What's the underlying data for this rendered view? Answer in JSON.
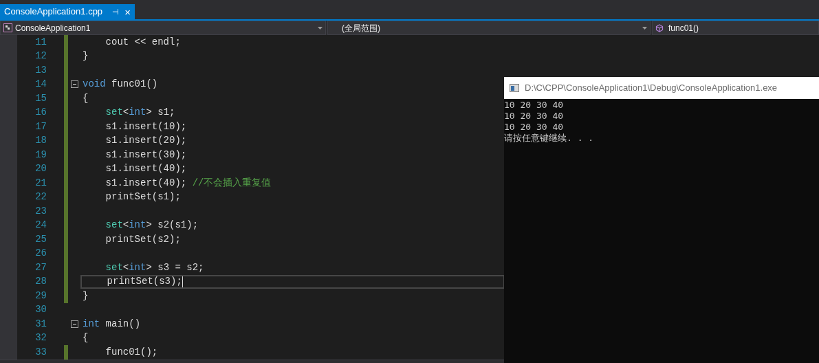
{
  "tab": {
    "title": "ConsoleApplication1.cpp",
    "pin": "⊣",
    "close": "×",
    "selected": true
  },
  "nav": {
    "project": "ConsoleApplication1",
    "scope": "(全局范围)",
    "member": "func01()"
  },
  "editor": {
    "lines": [
      {
        "number": "11",
        "changed": true,
        "fold": false,
        "current": false,
        "tokens": [
          {
            "kind": "plain",
            "text": "    cout << endl;"
          }
        ]
      },
      {
        "number": "12",
        "changed": true,
        "fold": false,
        "current": false,
        "tokens": [
          {
            "kind": "plain",
            "text": "}"
          }
        ]
      },
      {
        "number": "13",
        "changed": true,
        "fold": false,
        "current": false
      },
      {
        "number": "14",
        "changed": true,
        "fold": true,
        "current": false,
        "tokens": [
          {
            "kind": "keyword",
            "text": "void"
          },
          {
            "kind": "plain",
            "text": " func01()"
          }
        ]
      },
      {
        "number": "15",
        "changed": true,
        "fold": false,
        "current": false,
        "tokens": [
          {
            "kind": "plain",
            "text": "{"
          }
        ]
      },
      {
        "number": "16",
        "changed": true,
        "fold": false,
        "current": false,
        "tokens": [
          {
            "kind": "type",
            "text": "    set"
          },
          {
            "kind": "plain",
            "text": "<"
          },
          {
            "kind": "keyword",
            "text": "int"
          },
          {
            "kind": "plain",
            "text": "> s1;"
          }
        ]
      },
      {
        "number": "17",
        "changed": true,
        "fold": false,
        "current": false,
        "tokens": [
          {
            "kind": "plain",
            "text": "    s1.insert(10);"
          }
        ]
      },
      {
        "number": "18",
        "changed": true,
        "fold": false,
        "current": false,
        "tokens": [
          {
            "kind": "plain",
            "text": "    s1.insert(20);"
          }
        ]
      },
      {
        "number": "19",
        "changed": true,
        "fold": false,
        "current": false,
        "tokens": [
          {
            "kind": "plain",
            "text": "    s1.insert(30);"
          }
        ]
      },
      {
        "number": "20",
        "changed": true,
        "fold": false,
        "current": false,
        "tokens": [
          {
            "kind": "plain",
            "text": "    s1.insert(40);"
          }
        ]
      },
      {
        "number": "21",
        "changed": true,
        "fold": false,
        "current": false,
        "tokens": [
          {
            "kind": "plain",
            "text": "    s1.insert(40); "
          },
          {
            "kind": "comment",
            "text": "//不会插入重复值"
          }
        ]
      },
      {
        "number": "22",
        "changed": true,
        "fold": false,
        "current": false,
        "tokens": [
          {
            "kind": "plain",
            "text": "    printSet(s1);"
          }
        ]
      },
      {
        "number": "23",
        "changed": true,
        "fold": false,
        "current": false
      },
      {
        "number": "24",
        "changed": true,
        "fold": false,
        "current": false,
        "tokens": [
          {
            "kind": "type",
            "text": "    set"
          },
          {
            "kind": "plain",
            "text": "<"
          },
          {
            "kind": "keyword",
            "text": "int"
          },
          {
            "kind": "plain",
            "text": "> s2(s1);"
          }
        ]
      },
      {
        "number": "25",
        "changed": true,
        "fold": false,
        "current": false,
        "tokens": [
          {
            "kind": "plain",
            "text": "    printSet(s2);"
          }
        ]
      },
      {
        "number": "26",
        "changed": true,
        "fold": false,
        "current": false
      },
      {
        "number": "27",
        "changed": true,
        "fold": false,
        "current": false,
        "tokens": [
          {
            "kind": "type",
            "text": "    set"
          },
          {
            "kind": "plain",
            "text": "<"
          },
          {
            "kind": "keyword",
            "text": "int"
          },
          {
            "kind": "plain",
            "text": "> s3 = s2;"
          }
        ]
      },
      {
        "number": "28",
        "changed": true,
        "fold": false,
        "current": true,
        "tokens": [
          {
            "kind": "plain",
            "text": "    printSet(s3);"
          }
        ]
      },
      {
        "number": "29",
        "changed": true,
        "fold": false,
        "current": false,
        "tokens": [
          {
            "kind": "plain",
            "text": "}"
          }
        ]
      },
      {
        "number": "30",
        "changed": false,
        "fold": false,
        "current": false
      },
      {
        "number": "31",
        "changed": false,
        "fold": true,
        "current": false,
        "tokens": [
          {
            "kind": "keyword",
            "text": "int"
          },
          {
            "kind": "plain",
            "text": " main()"
          }
        ]
      },
      {
        "number": "32",
        "changed": false,
        "fold": false,
        "current": false,
        "tokens": [
          {
            "kind": "plain",
            "text": "{"
          }
        ]
      },
      {
        "number": "33",
        "changed": true,
        "fold": false,
        "current": false,
        "tokens": [
          {
            "kind": "plain",
            "text": "    func01();"
          }
        ]
      }
    ]
  },
  "console": {
    "title": "D:\\C\\CPP\\ConsoleApplication1\\Debug\\ConsoleApplication1.exe",
    "output": [
      "10 20 30 40",
      "10 20 30 40",
      "10 20 30 40",
      "请按任意键继续. . ."
    ]
  }
}
